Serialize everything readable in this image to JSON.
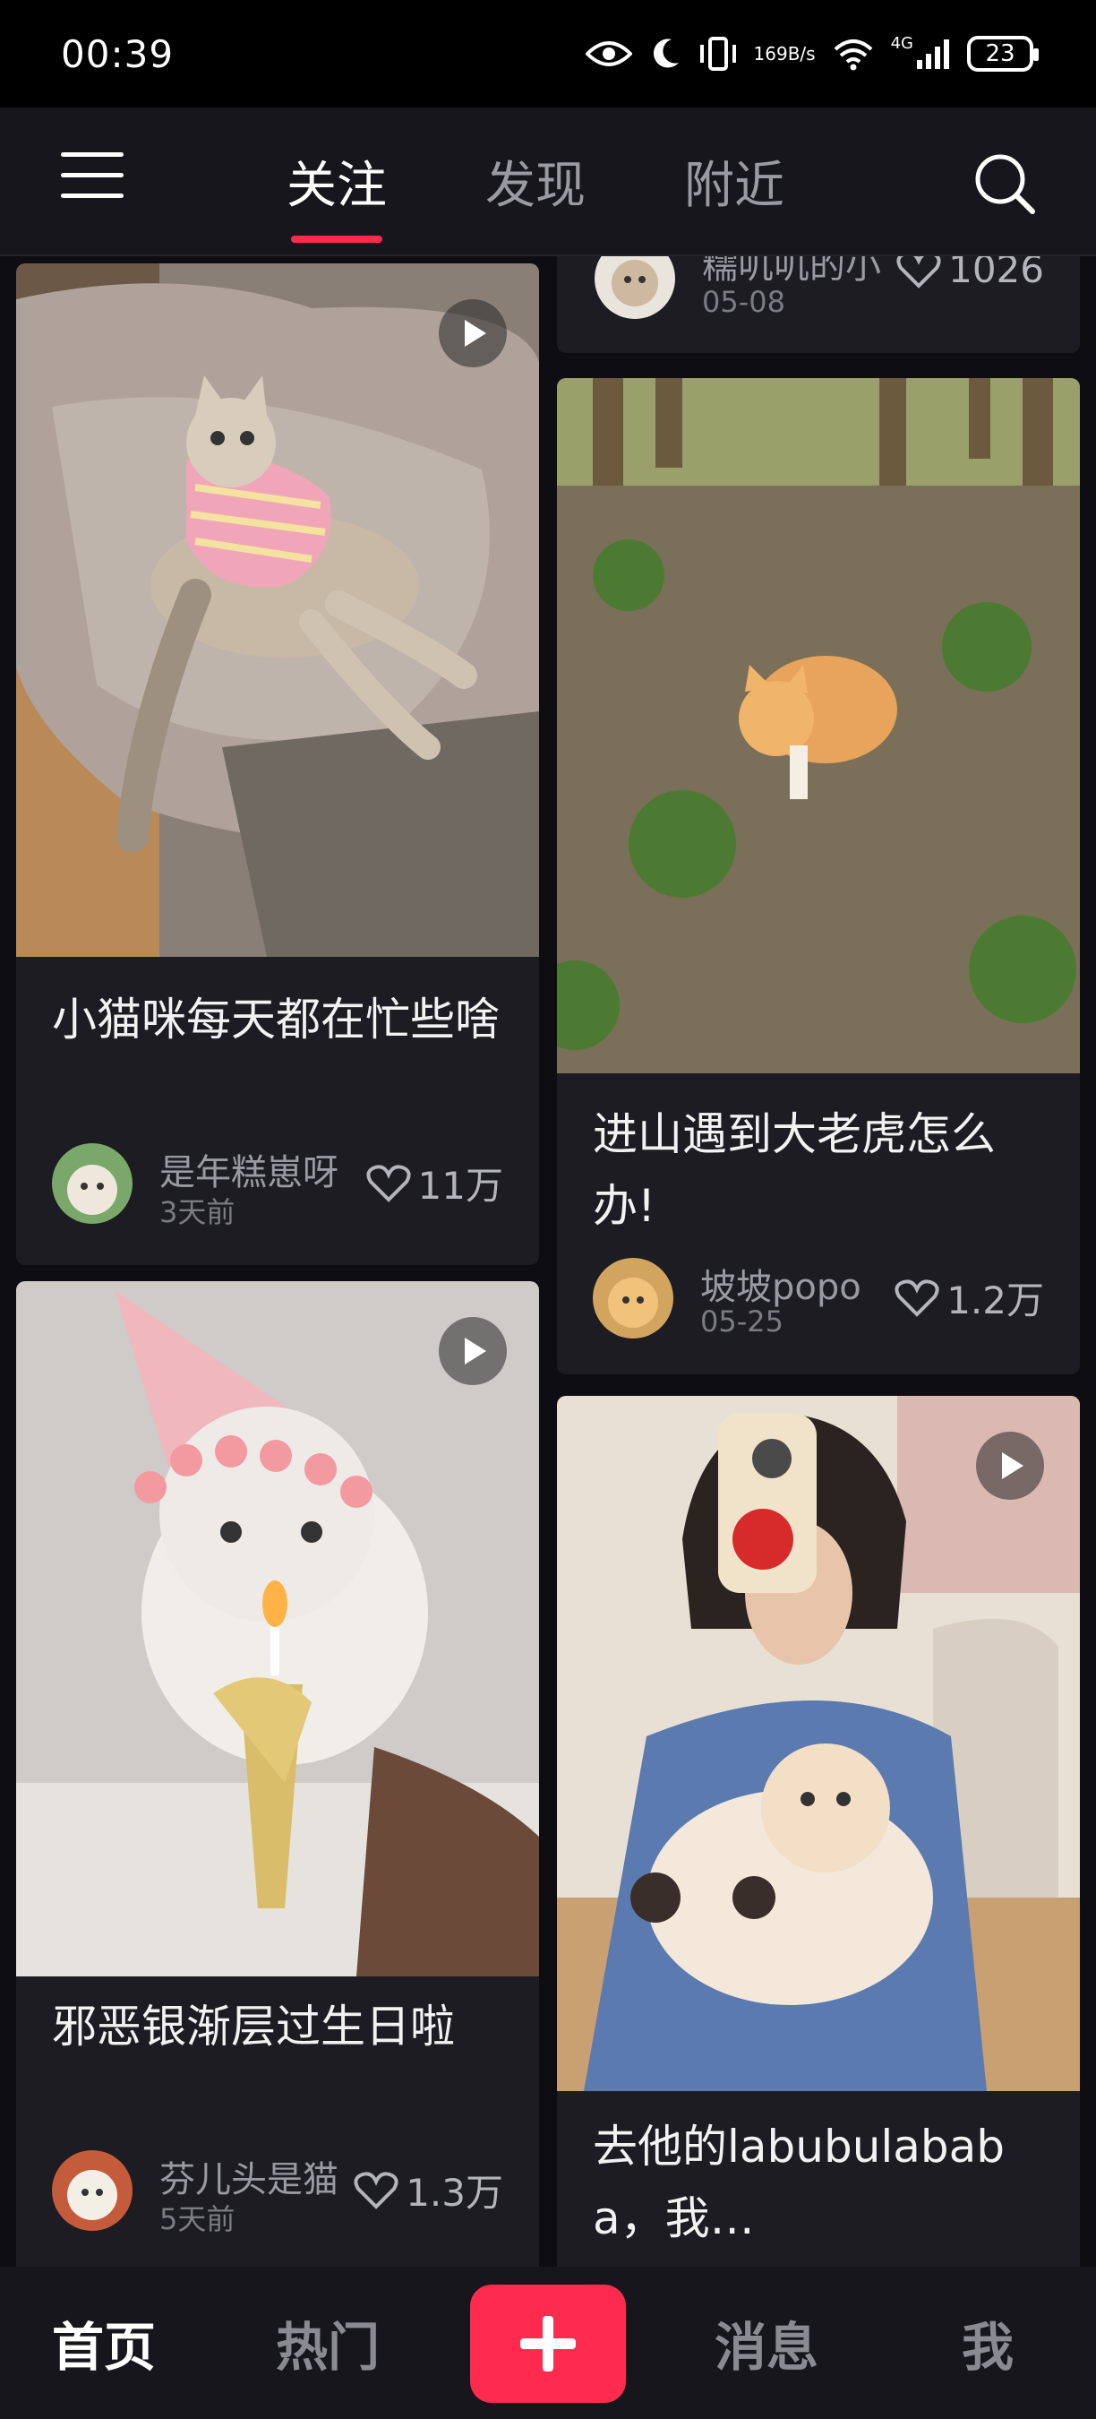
{
  "status_bar": {
    "time": "00:39",
    "net_speed_value": "169",
    "net_speed_unit": "B/s",
    "network": "4G",
    "battery": "23"
  },
  "top_nav": {
    "tabs": [
      {
        "label": "关注",
        "active": true
      },
      {
        "label": "发现",
        "active": false
      },
      {
        "label": "附近",
        "active": false
      }
    ]
  },
  "feed": {
    "cards": [
      {
        "title": "小猫咪每天都在忙些啥",
        "author": "是年糕崽呀",
        "date": "3天前",
        "likes": "11万",
        "is_video": true
      },
      {
        "title": "",
        "author": "糯叽叽的小",
        "date": "05-08",
        "likes": "1026",
        "is_video": false
      },
      {
        "title": "进山遇到大老虎怎么办!",
        "author": "坡坡popo",
        "date": "05-25",
        "likes": "1.2万",
        "is_video": false
      },
      {
        "title": "邪恶银渐层过生日啦",
        "author": "芬儿头是猫",
        "date": "5天前",
        "likes": "1.3万",
        "is_video": true
      },
      {
        "title": "去他的labubulababa，我…",
        "author": "",
        "date": "",
        "likes": "",
        "is_video": true
      }
    ]
  },
  "bottom_nav": {
    "items": [
      {
        "label": "首页",
        "active": true
      },
      {
        "label": "热门",
        "active": false
      },
      {
        "label": "消息",
        "active": false
      },
      {
        "label": "我",
        "active": false
      }
    ],
    "add_icon": "plus-icon"
  },
  "colors": {
    "accent": "#ff2b4f",
    "background": "#0e0e12",
    "card": "#1c1c22"
  }
}
